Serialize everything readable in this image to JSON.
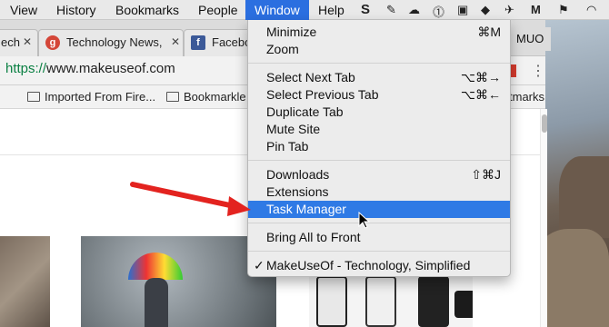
{
  "menubar": {
    "items": [
      "View",
      "History",
      "Bookmarks",
      "People",
      "Window",
      "Help"
    ],
    "active": "Window"
  },
  "tabs": [
    {
      "label": "ech",
      "favicon": "none"
    },
    {
      "label": "Technology News,",
      "favicon": "g"
    },
    {
      "label": "Faceboo",
      "favicon": "f"
    }
  ],
  "profile": "MUO",
  "address": {
    "scheme": "https://",
    "rest": "www.makeuseof.com"
  },
  "bookmarks": [
    {
      "label": "Imported From Fire..."
    },
    {
      "label": "Bookmarkle"
    },
    {
      "label": "tmarks"
    }
  ],
  "window_menu": {
    "minimize": {
      "label": "Minimize",
      "shortcut": "⌘M"
    },
    "zoom": {
      "label": "Zoom"
    },
    "select_next_tab": {
      "label": "Select Next Tab",
      "shortcut": "⌥⌘→"
    },
    "select_prev_tab": {
      "label": "Select Previous Tab",
      "shortcut": "⌥⌘←"
    },
    "duplicate_tab": {
      "label": "Duplicate Tab"
    },
    "mute_site": {
      "label": "Mute Site"
    },
    "pin_tab": {
      "label": "Pin Tab"
    },
    "downloads": {
      "label": "Downloads",
      "shortcut": "⇧⌘J"
    },
    "extensions": {
      "label": "Extensions"
    },
    "task_manager": {
      "label": "Task Manager"
    },
    "bring_all_to_front": {
      "label": "Bring All to Front"
    },
    "current_window": {
      "label": "MakeUseOf - Technology, Simplified",
      "checked": true
    }
  },
  "colors": {
    "menu_highlight": "#2f7ae5",
    "annotation_arrow": "#e3231f"
  }
}
